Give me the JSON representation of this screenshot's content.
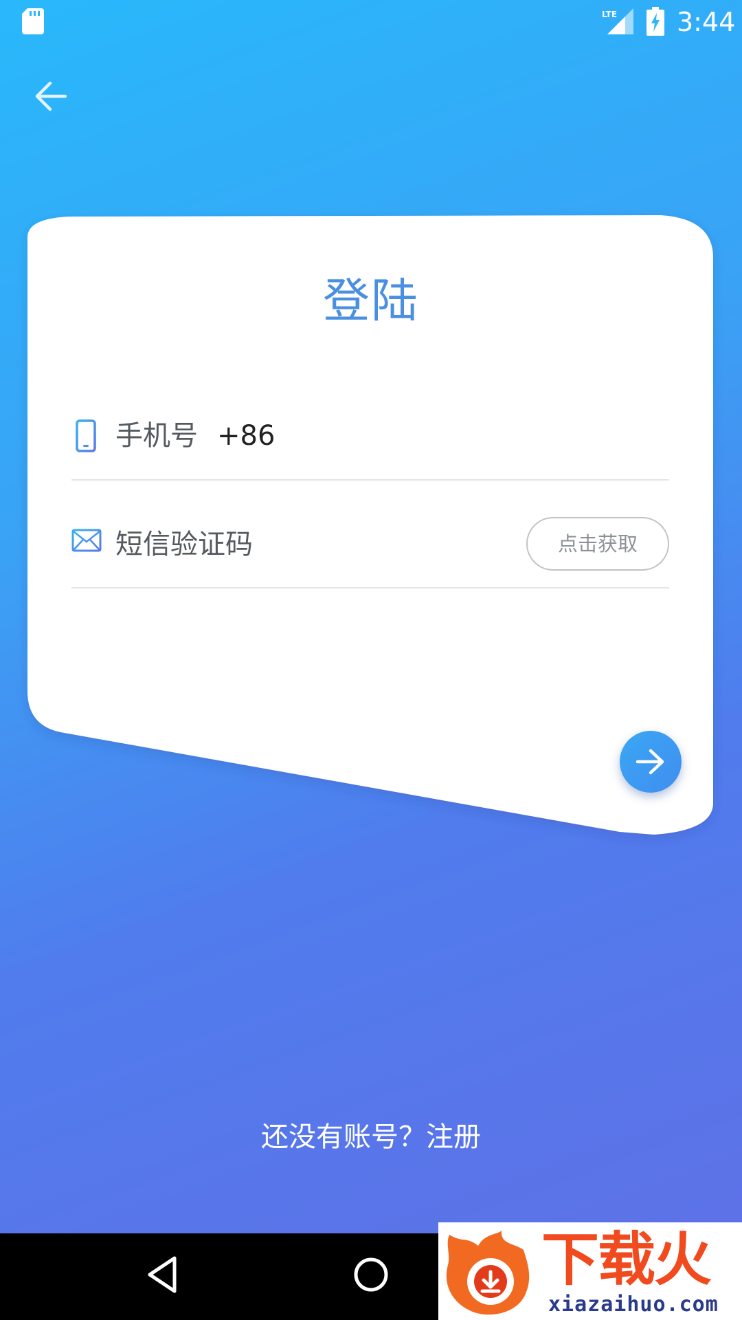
{
  "status_bar": {
    "network": "LTE",
    "time": "3:44",
    "icons": [
      "sd-card-icon",
      "signal-icon",
      "battery-charging-icon"
    ]
  },
  "header": {
    "back_icon": "arrow-left-icon"
  },
  "login_card": {
    "title": "登陆",
    "phone_field": {
      "icon": "phone-icon",
      "label": "手机号",
      "country_code": "+86"
    },
    "sms_field": {
      "icon": "mail-icon",
      "label": "短信验证码",
      "get_code_button": "点击获取"
    },
    "next_button_icon": "arrow-right-icon"
  },
  "footer": {
    "register_prompt": "还没有账号？注册"
  },
  "nav_bar": {
    "buttons": [
      "nav-back-icon",
      "nav-home-icon",
      "nav-recent-icon"
    ]
  },
  "watermark": {
    "name": "下载火",
    "url": "xiazaihuo.com"
  },
  "colors": {
    "gradient_top": "#29b8fb",
    "gradient_bottom": "#6070e6",
    "title": "#4a8fe0",
    "card": "#ffffff"
  }
}
